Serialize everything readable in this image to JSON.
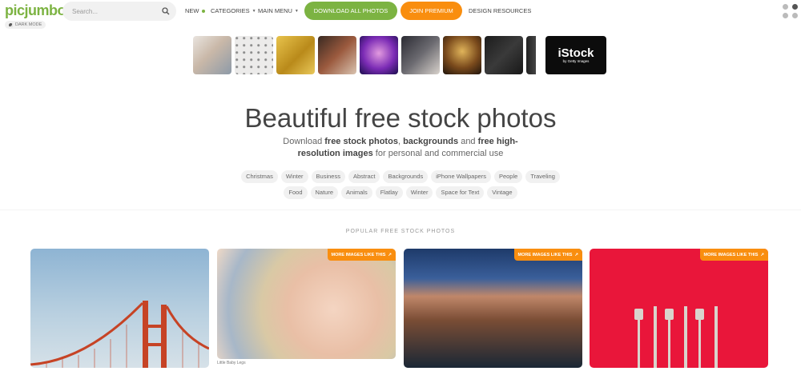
{
  "header": {
    "logo": "picjumbo",
    "dark_mode_label": "DARK MODE",
    "search_placeholder": "Search...",
    "nav": {
      "new": "NEW",
      "categories": "CATEGORIES",
      "main_menu": "MAIN MENU",
      "design_resources": "DESIGN RESOURCES"
    },
    "download_all": "DOWNLOAD ALL PHOTOS",
    "join_premium": "JOIN PREMIUM"
  },
  "istock": {
    "name": "iStock",
    "byline": "by Getty Images"
  },
  "hero": {
    "title": "Beautiful free stock photos",
    "subtitle_parts": [
      "Download ",
      "free stock photos",
      ", ",
      "backgrounds",
      " and ",
      "free high-resolution images",
      " for personal and commercial use"
    ]
  },
  "tags_row1": [
    "Christmas",
    "Winter",
    "Business",
    "Abstract",
    "Backgrounds",
    "iPhone Wallpapers",
    "People",
    "Traveling"
  ],
  "tags_row2": [
    "Food",
    "Nature",
    "Animals",
    "Flatlay",
    "Winter",
    "Space for Text",
    "Vintage"
  ],
  "section_title": "POPULAR FREE STOCK PHOTOS",
  "cards": {
    "more_label": "MORE IMAGES LIKE THIS",
    "caption_baby": "Little Baby Legs"
  },
  "colors": {
    "brand_green": "#7cb342",
    "premium_orange": "#f98e0f"
  }
}
